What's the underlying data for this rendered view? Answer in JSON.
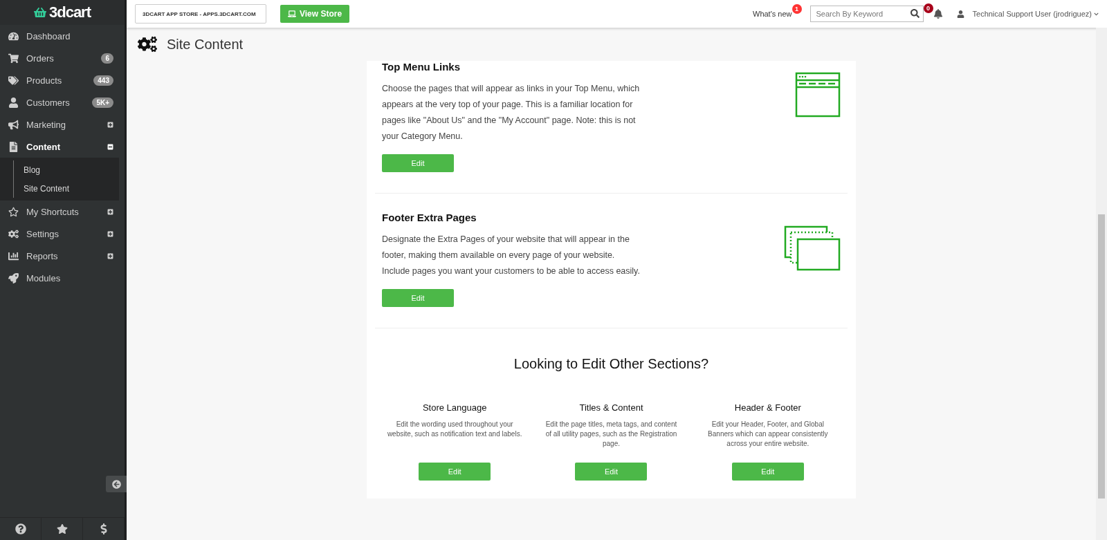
{
  "logo": {
    "text": "3dcart"
  },
  "sidebar": {
    "items": [
      {
        "label": "Dashboard",
        "selected": false
      },
      {
        "label": "Orders",
        "badge": "6",
        "selected": false
      },
      {
        "label": "Products",
        "badge": "443",
        "selected": false
      },
      {
        "label": "Customers",
        "badge": "5K+",
        "selected": false
      },
      {
        "label": "Marketing",
        "expanded": false,
        "selected": false
      },
      {
        "label": "Content",
        "expanded": true,
        "selected": true,
        "children": [
          {
            "label": "Blog"
          },
          {
            "label": "Site Content"
          }
        ]
      },
      {
        "label": "My Shortcuts",
        "expanded": false,
        "selected": false
      },
      {
        "label": "Settings",
        "expanded": false,
        "selected": false
      },
      {
        "label": "Reports",
        "expanded": false,
        "selected": false
      },
      {
        "label": "Modules",
        "selected": false
      }
    ]
  },
  "topbar": {
    "store_select": "3DCART APP STORE - APPS.3DCART.COM",
    "view_store": "View Store",
    "whats_new": "What's new",
    "whats_new_count": "1",
    "search": {
      "placeholder": "Search By Keyword"
    },
    "notifications": "0",
    "user": "Technical Support User (jrodriguez)"
  },
  "page": {
    "title": "Site Content"
  },
  "sections": [
    {
      "kind": "window",
      "title": "Top Menu Links",
      "text": "Choose the pages that will appear as links in your Top Menu, which appears at the very top of your page. This is a familiar location for pages like \"About Us\" and the \"My Account\" page. Note: this is not your Category Menu.",
      "button": "Edit"
    },
    {
      "kind": "pages",
      "title": "Footer Extra Pages",
      "text": "Designate the Extra Pages of your website that will appear in the footer, making them available on every page of your website. Include pages you want your customers to be able to access easily.",
      "button": "Edit"
    }
  ],
  "other": {
    "heading": "Looking to Edit Other Sections?",
    "columns": [
      {
        "title": "Store Language",
        "text": "Edit the wording used throughout your website, such as notification text and labels.",
        "button": "Edit"
      },
      {
        "title": "Titles & Content",
        "text": "Edit the page titles, meta tags, and content of all utility pages, such as the Registration page.",
        "button": "Edit"
      },
      {
        "title": "Header & Footer",
        "text": "Edit your Header, Footer, and Global Banners which can appear consistently across your entire website.",
        "button": "Edit"
      }
    ]
  }
}
